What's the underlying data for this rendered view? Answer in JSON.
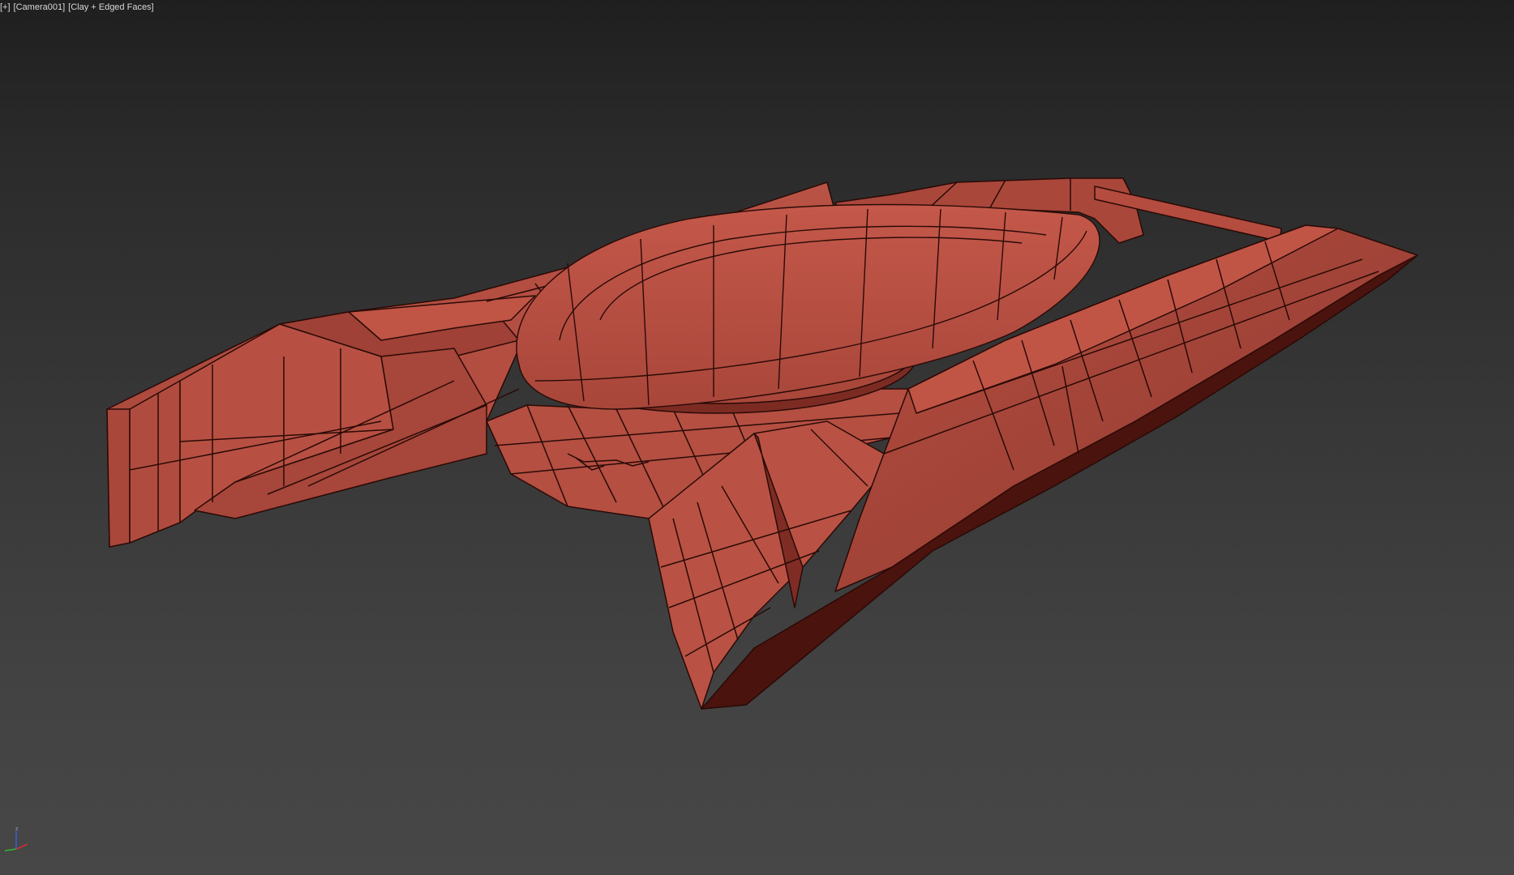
{
  "viewport": {
    "menu_label": "[+]",
    "camera_label": "[Camera001]",
    "shading_label": "[Clay + Edged Faces]"
  },
  "model": {
    "name": "hover ship",
    "clay_color": "#b24a3e",
    "edge_color": "#2a0a06",
    "shadow_color": "#5a1a14"
  },
  "gizmo": {
    "axes": [
      "x",
      "y",
      "z"
    ],
    "z_label": "z",
    "colors": {
      "x": "#c83232",
      "y": "#32b432",
      "z": "#3c5ad2"
    }
  }
}
